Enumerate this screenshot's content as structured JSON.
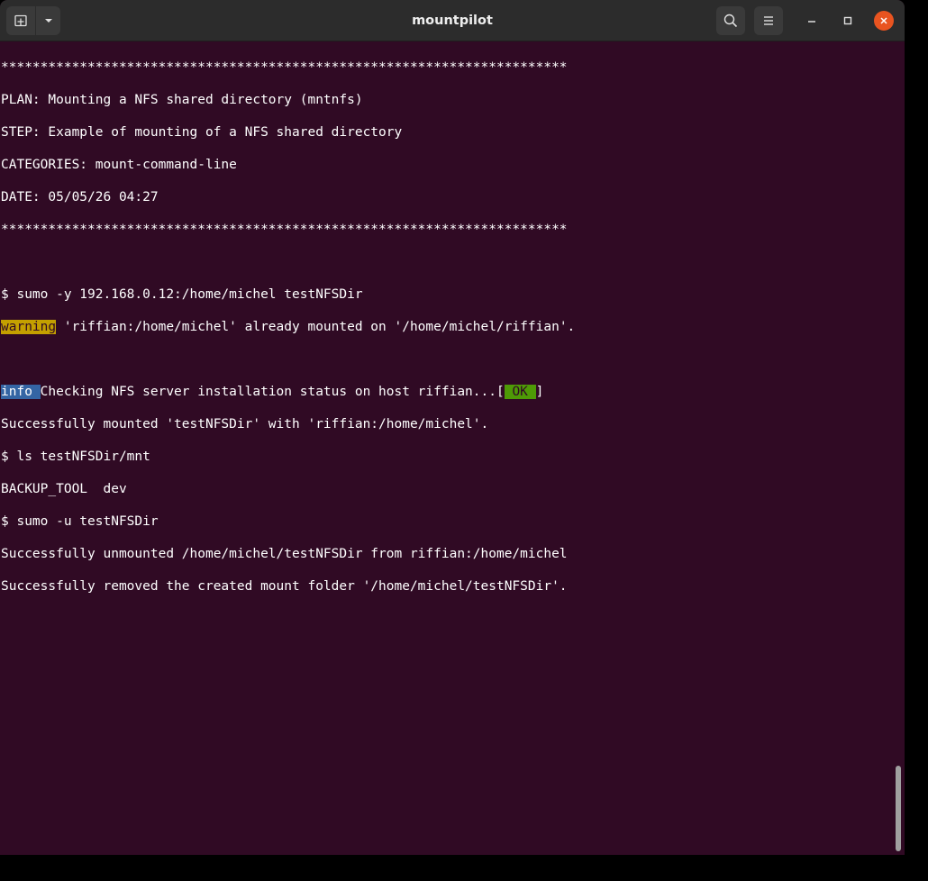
{
  "window": {
    "title": "mountpilot"
  },
  "terminal": {
    "banner_top": "************************************************************************",
    "plan": "PLAN: Mounting a NFS shared directory (mntnfs)",
    "step": "STEP: Example of mounting of a NFS shared directory",
    "categories": "CATEGORIES: mount-command-line",
    "date": "DATE: 05/05/26 04:27",
    "banner_bottom": "************************************************************************",
    "cmd1": "$ sumo -y 192.168.0.12:/home/michel testNFSDir",
    "warning_tag": "warning",
    "warning_msg": " 'riffian:/home/michel' already mounted on '/home/michel/riffian'.",
    "info_tag": "info ",
    "info_msg": "Checking NFS server installation status on host riffian...[",
    "ok_tag": " OK ",
    "ok_close": "]",
    "mounted_msg": "Successfully mounted 'testNFSDir' with 'riffian:/home/michel'.",
    "cmd2": "$ ls testNFSDir/mnt",
    "ls_output": "BACKUP_TOOL  dev",
    "cmd3": "$ sumo -u testNFSDir",
    "unmounted_msg": "Successfully unmounted /home/michel/testNFSDir from riffian:/home/michel",
    "removed_msg": "Successfully removed the created mount folder '/home/michel/testNFSDir'."
  },
  "icons": {
    "new_tab": "new-tab-icon",
    "dropdown": "chevron-down-icon",
    "search": "search-icon",
    "menu": "hamburger-menu-icon",
    "minimize": "minimize-icon",
    "maximize": "maximize-icon",
    "close": "close-icon"
  },
  "colors": {
    "terminal_bg": "#300a24",
    "titlebar_bg": "#2c2c2c",
    "warning_bg": "#c4a000",
    "info_bg": "#3465a4",
    "ok_bg": "#4e9a06",
    "close_btn": "#e95420"
  }
}
